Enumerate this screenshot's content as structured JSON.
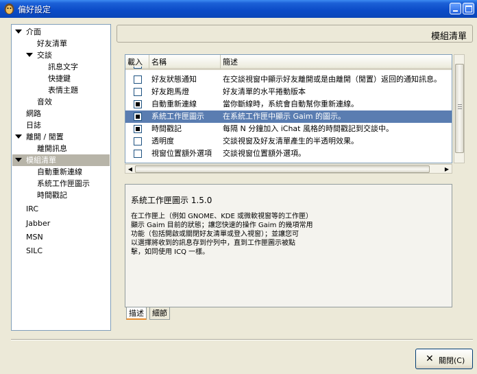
{
  "window": {
    "title": "偏好設定",
    "minimize_icon": "minimize-icon",
    "maximize_icon": "maximize-icon"
  },
  "tree": {
    "items": [
      {
        "label": "介面"
      },
      {
        "label": "好友清單"
      },
      {
        "label": "交談"
      },
      {
        "label": "訊息文字"
      },
      {
        "label": "快捷鍵"
      },
      {
        "label": "表情主題"
      },
      {
        "label": "音效"
      },
      {
        "label": "網路"
      },
      {
        "label": "日誌"
      },
      {
        "label": "離開 / 閒置"
      },
      {
        "label": "離開訊息"
      },
      {
        "label": "模組清單"
      },
      {
        "label": "自動重新連線"
      },
      {
        "label": "系統工作匣圖示"
      },
      {
        "label": "時間戳記"
      },
      {
        "label": "IRC"
      },
      {
        "label": "Jabber"
      },
      {
        "label": "MSN"
      },
      {
        "label": "SILC"
      }
    ]
  },
  "header": {
    "title": "模組清單"
  },
  "plugins": {
    "columns": [
      "載入",
      "名稱",
      "簡述"
    ],
    "rows": [
      {
        "name": "好友狀態通知",
        "desc": "在交談視窗中顯示好友離開或是由離開（閒置）返回的通知訊息。",
        "checked": false,
        "selected": false
      },
      {
        "name": "好友跑馬燈",
        "desc": "好友清單的水平捲動版本",
        "checked": false,
        "selected": false
      },
      {
        "name": "自動重新連線",
        "desc": "當你斷線時，系統會自動幫你重新連線。",
        "checked": true,
        "selected": false
      },
      {
        "name": "系統工作匣圖示",
        "desc": "在系統工作匣中顯示 Gaim 的圖示。",
        "checked": true,
        "selected": true
      },
      {
        "name": "時間戳記",
        "desc": "每隔 N 分鐘加入 iChat 風格的時間戳記到交談中。",
        "checked": true,
        "selected": false
      },
      {
        "name": "透明度",
        "desc": "交談視窗及好友清單產生的半透明效果。",
        "checked": false,
        "selected": false
      },
      {
        "name": "視窗位置額外選項",
        "desc": "交談視窗位置額外選項。",
        "checked": false,
        "selected": false
      }
    ]
  },
  "description": {
    "title": "系統工作匣圖示  1.5.0",
    "lines": [
      "在工作匣上（例如 GNOME、KDE 或微軟視窗等的工作匣）",
      "顯示 Gaim 目前的狀態；讓您快速的操作 Gaim 的幾項常用",
      "功能（包括開啟或關閉好友清單或登入視窗）；並讓您可",
      "以選擇將收到的訊息存到佇列中，直到工作匣圖示被點",
      "擊，如同使用 ICQ 一樣。"
    ]
  },
  "tabs": [
    "描述",
    "細節"
  ],
  "footer": {
    "close_label": "關閉(C)"
  }
}
